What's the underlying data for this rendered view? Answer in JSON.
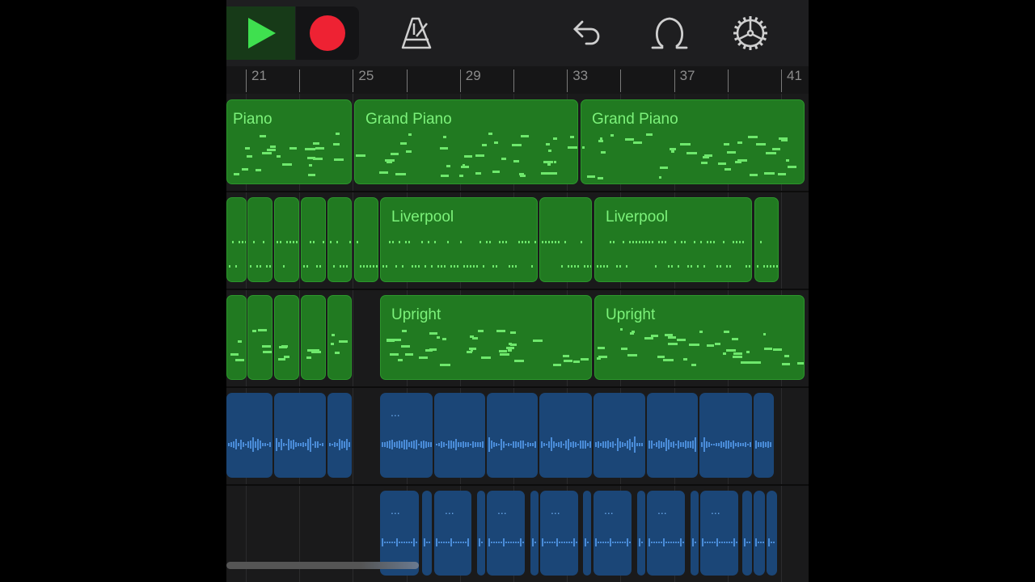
{
  "toolbar": {
    "play_icon": "play-icon",
    "record_icon": "record-icon",
    "metronome_icon": "metronome-icon",
    "undo_icon": "undo-icon",
    "loop_icon": "loop-browser-icon",
    "settings_icon": "gear-icon"
  },
  "ruler": {
    "bars": [
      "21",
      "25",
      "29",
      "33",
      "37",
      "41"
    ]
  },
  "tracks": [
    {
      "regions": [
        "Piano",
        "Grand Piano",
        "Grand Piano"
      ]
    },
    {
      "regions": [
        "Liverpool",
        "Liverpool"
      ]
    },
    {
      "regions": [
        "Upright",
        "Upright"
      ]
    },
    {
      "regions": [
        "..."
      ]
    },
    {
      "regions": [
        "...",
        "...",
        "...",
        "...",
        "...",
        "...",
        "..."
      ]
    }
  ],
  "colors": {
    "midi_region": "#217a21",
    "audio_region": "#1b4677",
    "play": "#3fe04f",
    "record": "#ee2233"
  }
}
